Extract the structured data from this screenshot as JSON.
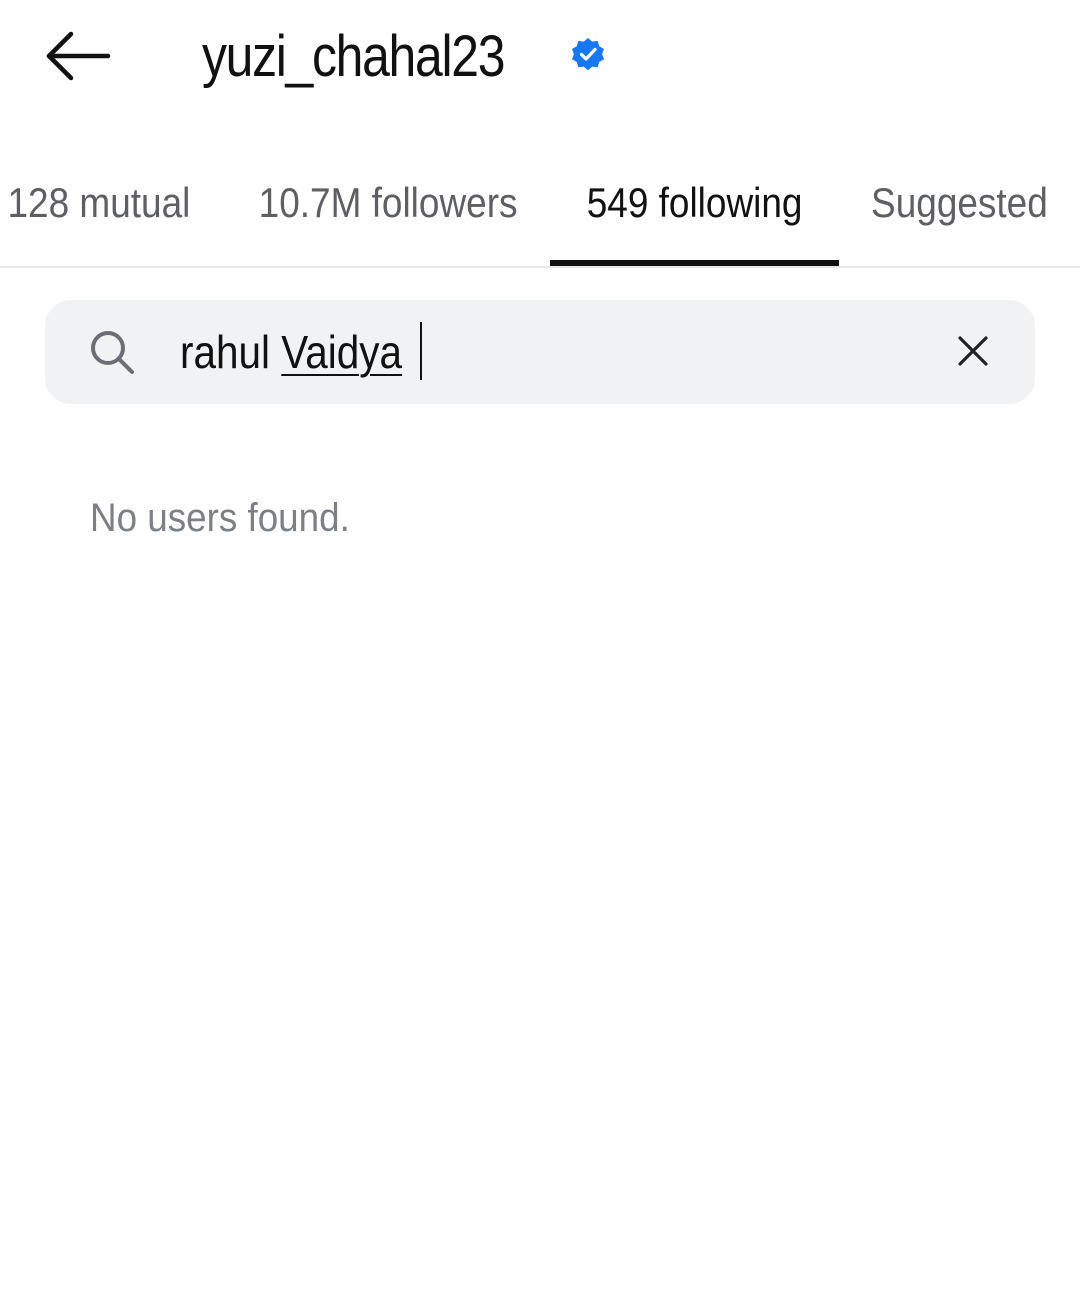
{
  "header": {
    "back_icon": "arrow-left-icon",
    "username": "yuzi_chahal23",
    "verified_icon": "verified-badge-icon",
    "verified_color": "#1877f2"
  },
  "tabs": [
    {
      "label": "128 mutual",
      "active": false
    },
    {
      "label": "10.7M followers",
      "active": false
    },
    {
      "label": "549 following",
      "active": true
    },
    {
      "label": "Suggested",
      "active": false
    }
  ],
  "search": {
    "icon": "search-icon",
    "value_first": "rahul ",
    "value_typed": "Vaidya",
    "clear_icon": "close-icon"
  },
  "results": {
    "empty_message": "No users found."
  },
  "colors": {
    "active_tab": "#111111",
    "inactive_tab": "#5d5f63",
    "search_bg": "#f1f2f4",
    "muted_text": "#7c7f84"
  }
}
